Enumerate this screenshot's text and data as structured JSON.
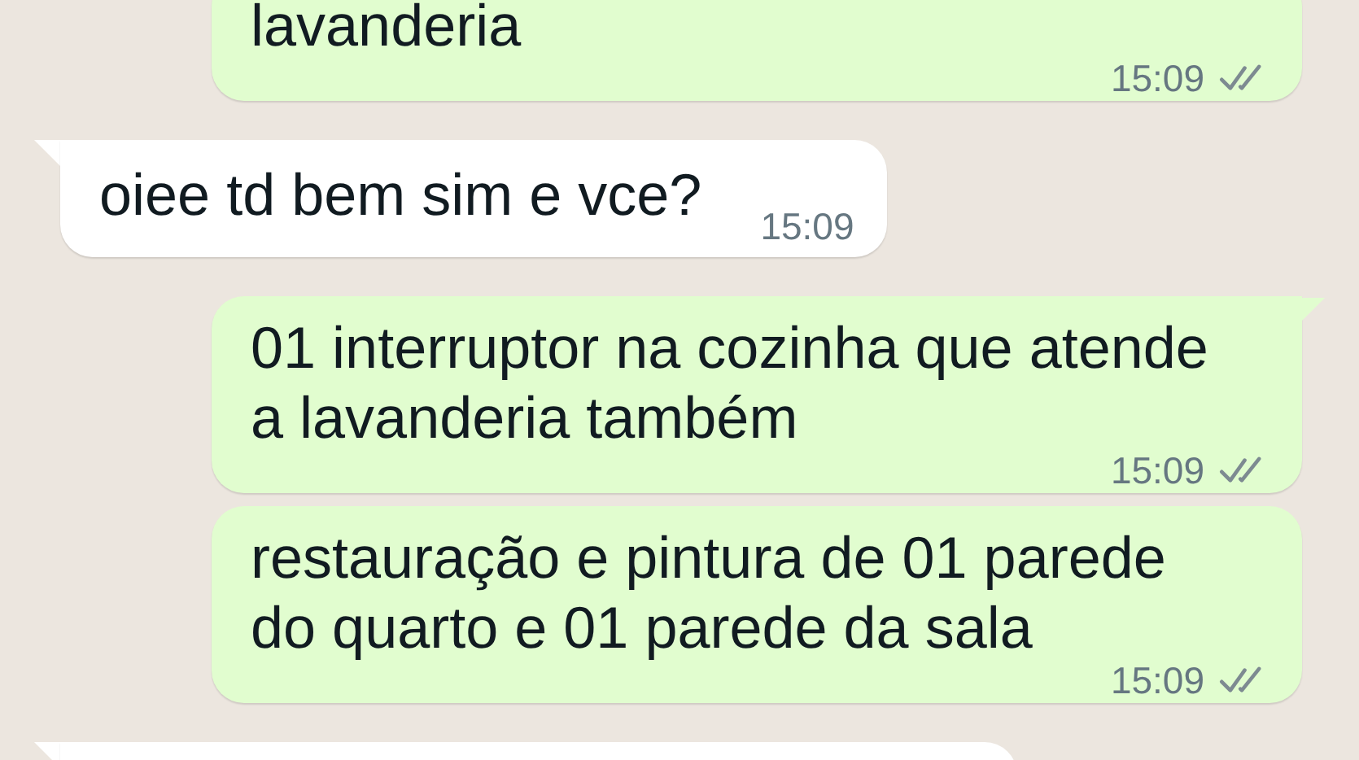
{
  "messages": [
    {
      "kind": "outgoing",
      "tail": false,
      "text": "lavanderia",
      "time": "15:09",
      "read": false
    },
    {
      "kind": "incoming",
      "tail": true,
      "text": "oiee td bem sim e vce?",
      "time": "15:09"
    },
    {
      "kind": "outgoing",
      "tail": true,
      "text": "01 interruptor na cozinha que atende a lavanderia também",
      "time": "15:09",
      "read": false
    },
    {
      "kind": "outgoing",
      "tail": false,
      "text": "restauração e pintura de 01 parede\ndo quarto e 01 parede da sala",
      "time": "15:09",
      "read": false
    },
    {
      "kind": "incoming",
      "tail": true
    }
  ]
}
